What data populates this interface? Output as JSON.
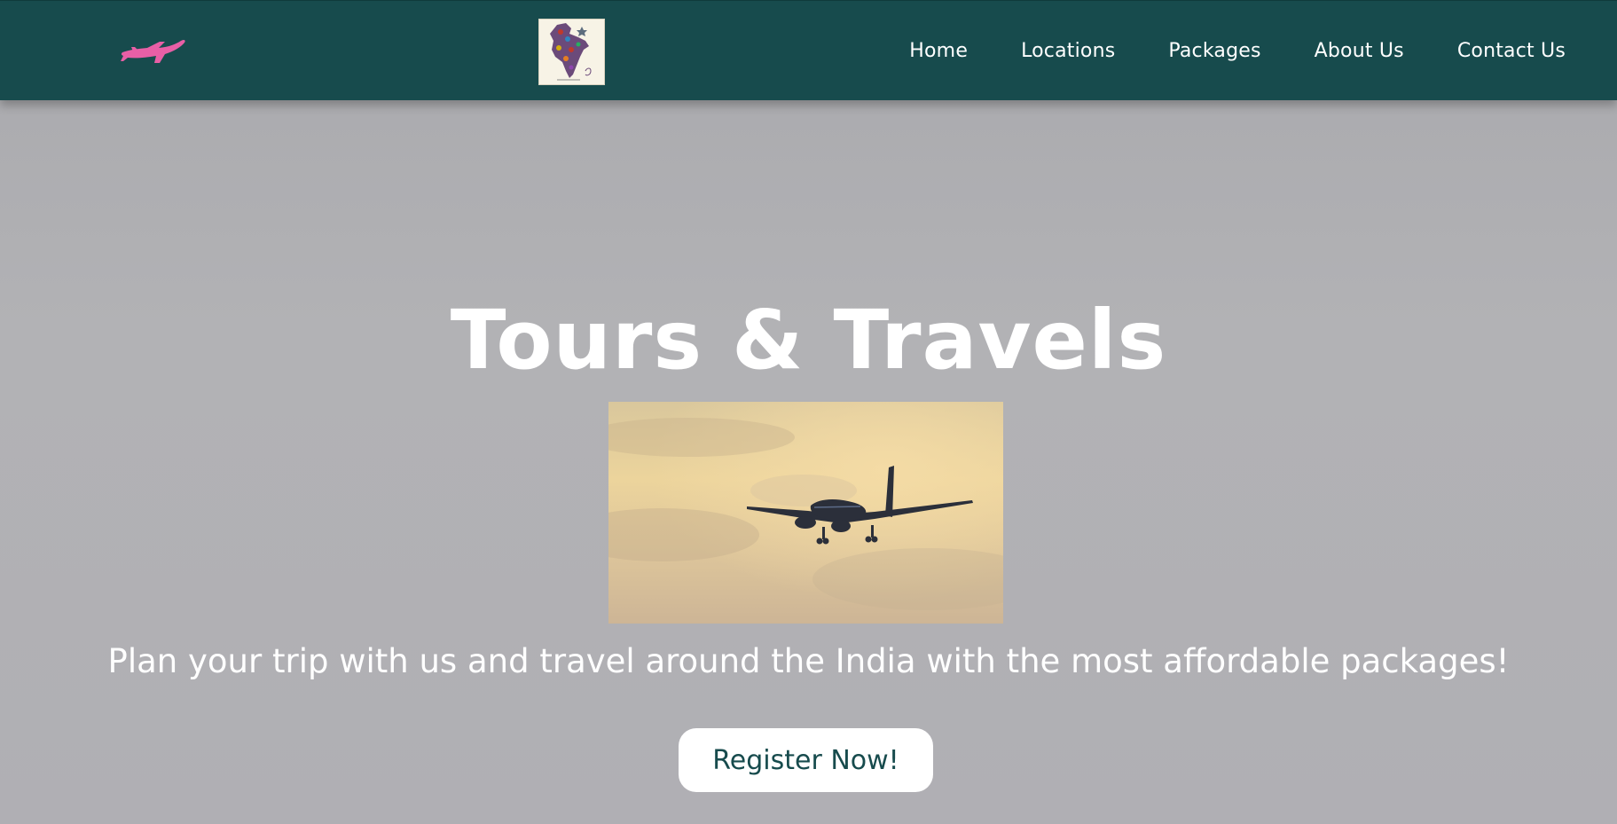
{
  "brand": {
    "logo_icon": "airplane-icon",
    "map_logo": "india-map-logo"
  },
  "nav": {
    "items": [
      {
        "label": "Home"
      },
      {
        "label": "Locations"
      },
      {
        "label": "Packages"
      },
      {
        "label": "About Us"
      },
      {
        "label": "Contact Us"
      }
    ]
  },
  "hero": {
    "title": "Tours & Travels",
    "image": "airplane-in-sky-photo",
    "tagline": "Plan your trip with us and travel around the India with the most affordable packages!",
    "cta_label": "Register Now!"
  },
  "colors": {
    "navbar": "#174b4d",
    "background": "#b0afb4",
    "logo_plane": "#e85fa6",
    "button_text": "#174b4d"
  }
}
